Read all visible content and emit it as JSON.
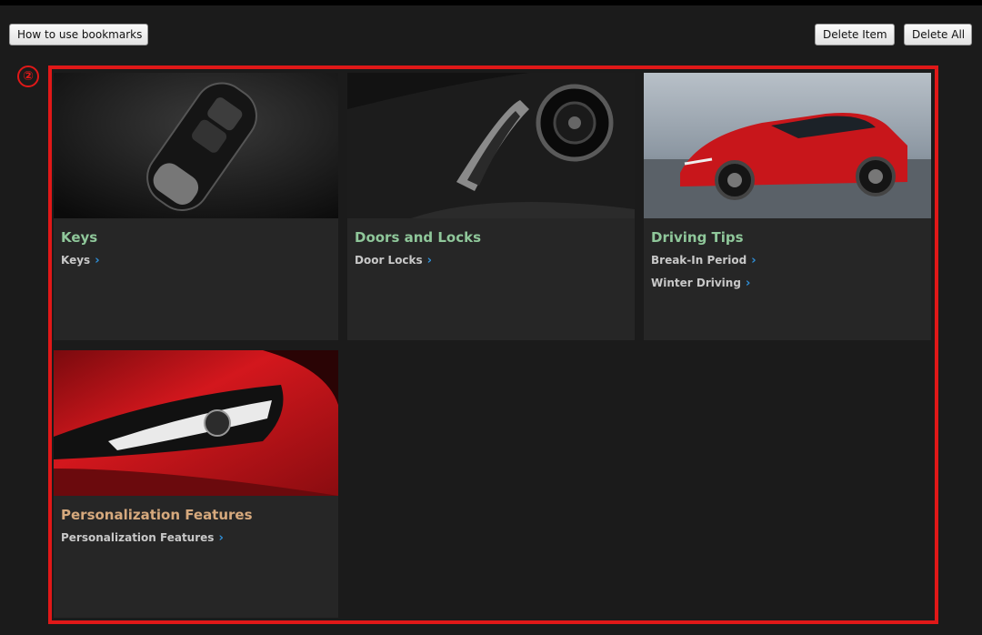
{
  "toolbar": {
    "howto_label": "How to use bookmarks",
    "delete_item_label": "Delete Item",
    "delete_all_label": "Delete All"
  },
  "marker": {
    "label": "②",
    "color": "#e01818"
  },
  "tiles": [
    {
      "title": "Keys",
      "title_color": "#8fc79a",
      "image": "smart-key-fob-photo",
      "links": [
        "Keys"
      ]
    },
    {
      "title": "Doors and Locks",
      "title_color": "#8fc79a",
      "image": "door-handle-interior-photo",
      "links": [
        "Door Locks"
      ]
    },
    {
      "title": "Driving Tips",
      "title_color": "#8fc79a",
      "image": "red-suv-driving-photo",
      "links": [
        "Break-In Period",
        "Winter Driving"
      ]
    },
    {
      "title": "Personalization Features",
      "title_color": "#d6a97d",
      "image": "red-car-headlight-photo",
      "links": [
        "Personalization Features"
      ]
    }
  ],
  "colors": {
    "link_chevron": "#2f8fd8",
    "background": "#1b1b1b",
    "tile": "#262626"
  }
}
